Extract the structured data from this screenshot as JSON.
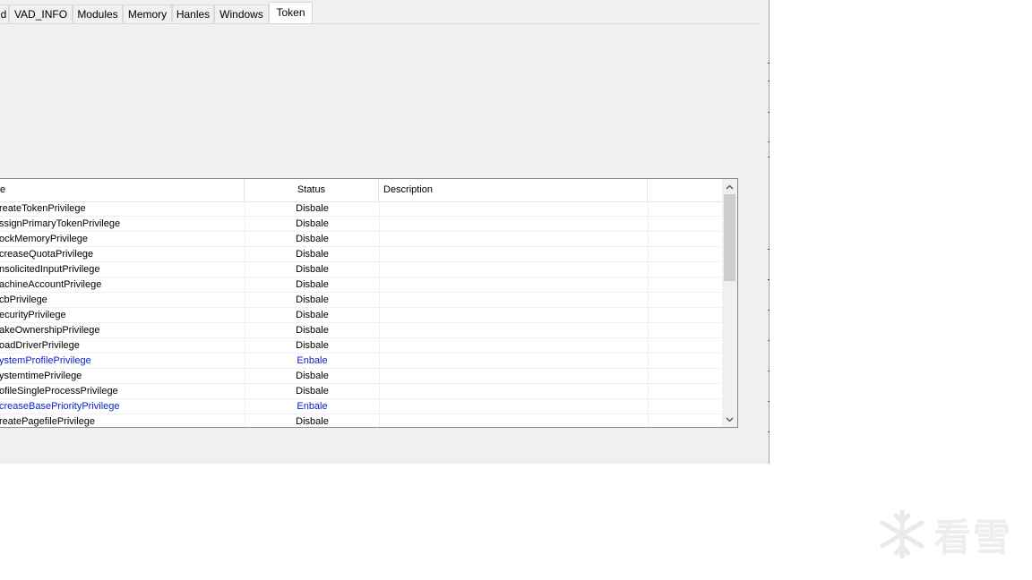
{
  "tabs": [
    {
      "label": "d",
      "active": false
    },
    {
      "label": "VAD_INFO",
      "active": false
    },
    {
      "label": "Modules",
      "active": false
    },
    {
      "label": "Memory",
      "active": false
    },
    {
      "label": "Hanles",
      "active": false
    },
    {
      "label": "Windows",
      "active": false
    },
    {
      "label": "Token",
      "active": true
    }
  ],
  "table": {
    "columns": [
      "e",
      "Status",
      "Description",
      ""
    ],
    "rows": [
      {
        "name": "reateTokenPrivilege",
        "status": "Disbale",
        "description": "",
        "enabled": false
      },
      {
        "name": "ssignPrimaryTokenPrivilege",
        "status": "Disbale",
        "description": "",
        "enabled": false
      },
      {
        "name": "ockMemoryPrivilege",
        "status": "Disbale",
        "description": "",
        "enabled": false
      },
      {
        "name": "creaseQuotaPrivilege",
        "status": "Disbale",
        "description": "",
        "enabled": false
      },
      {
        "name": "nsolicitedInputPrivilege",
        "status": "Disbale",
        "description": "",
        "enabled": false
      },
      {
        "name": "achineAccountPrivilege",
        "status": "Disbale",
        "description": "",
        "enabled": false
      },
      {
        "name": "cbPrivilege",
        "status": "Disbale",
        "description": "",
        "enabled": false
      },
      {
        "name": "ecurityPrivilege",
        "status": "Disbale",
        "description": "",
        "enabled": false
      },
      {
        "name": "akeOwnershipPrivilege",
        "status": "Disbale",
        "description": "",
        "enabled": false
      },
      {
        "name": "oadDriverPrivilege",
        "status": "Disbale",
        "description": "",
        "enabled": false
      },
      {
        "name": "ystemProfilePrivilege",
        "status": "Enbale",
        "description": "",
        "enabled": true
      },
      {
        "name": "ystemtimePrivilege",
        "status": "Disbale",
        "description": "",
        "enabled": false
      },
      {
        "name": "ofileSingleProcessPrivilege",
        "status": "Disbale",
        "description": "",
        "enabled": false
      },
      {
        "name": "creaseBasePriorityPrivilege",
        "status": "Enbale",
        "description": "",
        "enabled": true
      },
      {
        "name": "reatePagefilePrivilege",
        "status": "Disbale",
        "description": "",
        "enabled": false
      }
    ]
  },
  "scrollbar": {
    "up_icon": "chevron-up-icon",
    "down_icon": "chevron-down-icon"
  },
  "watermark": {
    "text": "看雪",
    "icon": "snowflake-icon"
  },
  "colors": {
    "enabled_text": "#0b23c8",
    "window_bg": "#f0f0f0"
  }
}
